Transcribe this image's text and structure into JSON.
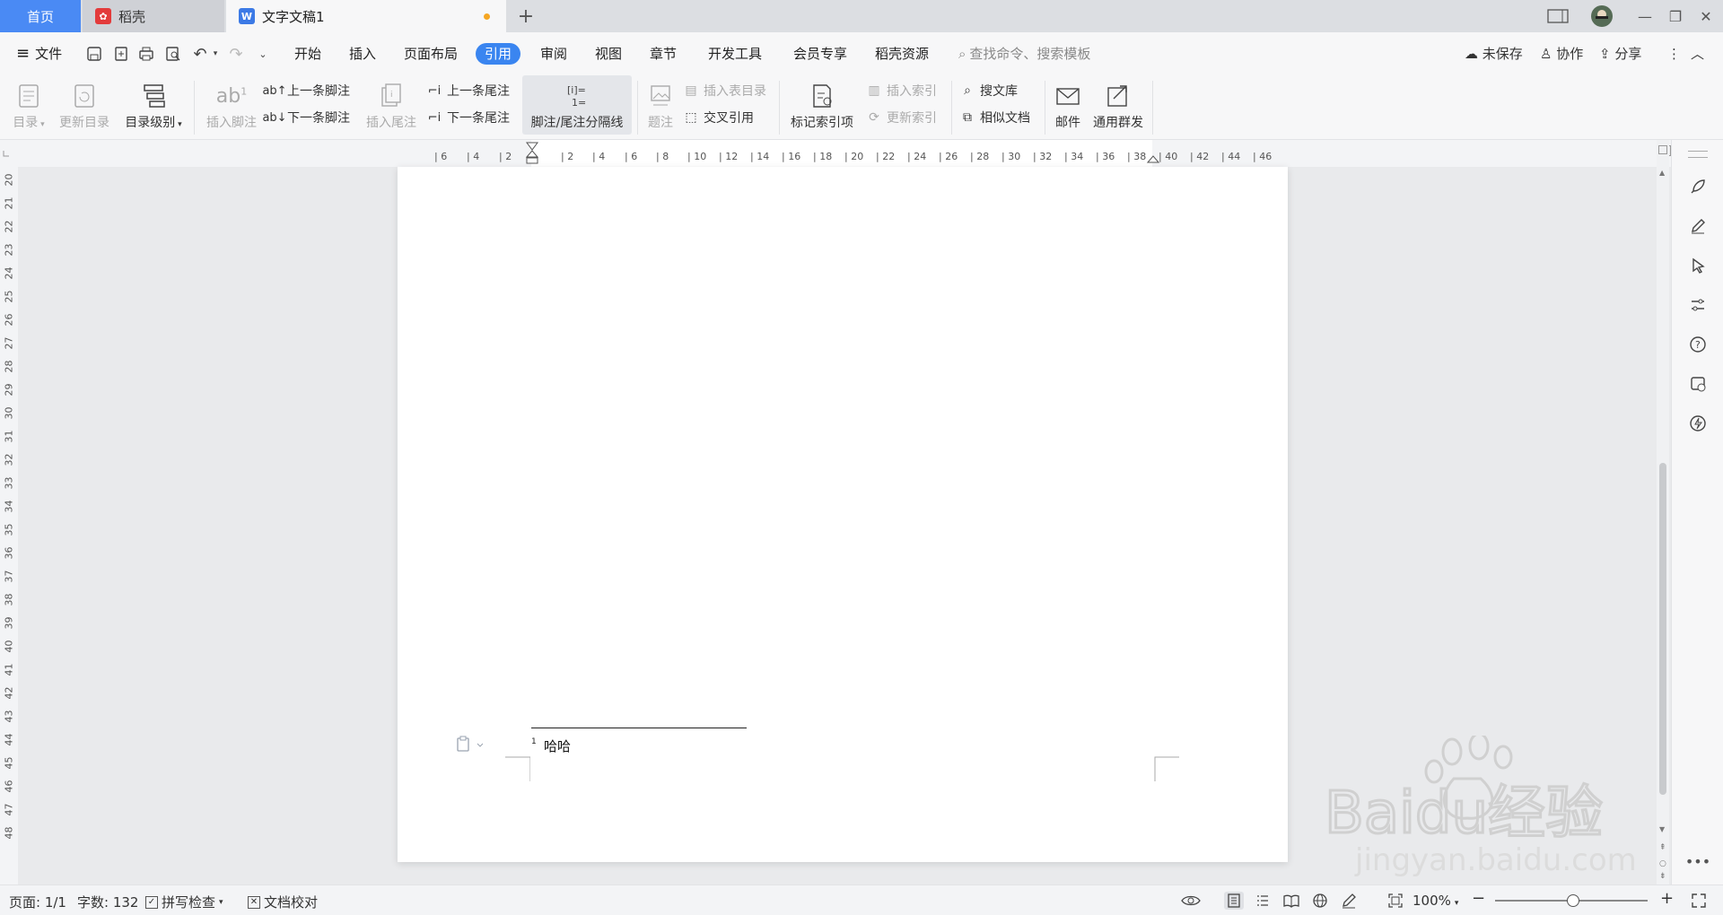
{
  "tabs": {
    "home": "首页",
    "daoke": "稻壳",
    "doc": "文字文稿1",
    "add": "+"
  },
  "window": {
    "page_badge": "1",
    "minimize": "—",
    "restore": "❐",
    "close": "✕"
  },
  "menu": {
    "file": "文件",
    "items": [
      "开始",
      "插入",
      "页面布局",
      "引用",
      "审阅",
      "视图",
      "章节",
      "开发工具",
      "会员专享",
      "稻壳资源"
    ],
    "active": "引用",
    "search_placeholder": "查找命令、搜索模板",
    "unsaved": "未保存",
    "collab": "协作",
    "share": "分享"
  },
  "ribbon": {
    "toc": "目录",
    "update_toc": "更新目录",
    "toc_level": "目录级别",
    "insert_footnote": "插入脚注",
    "prev_footnote": "上一条脚注",
    "next_footnote": "下一条脚注",
    "insert_endnote": "插入尾注",
    "prev_endnote": "上一条尾注",
    "next_endnote": "下一条尾注",
    "separator": "脚注/尾注分隔线",
    "caption": "题注",
    "insert_table_toc": "插入表目录",
    "cross_ref": "交叉引用",
    "mark_index": "标记索引项",
    "insert_index": "插入索引",
    "update_index": "更新索引",
    "search_lib": "搜文库",
    "similar_doc": "相似文档",
    "mail": "邮件",
    "group_send": "通用群发"
  },
  "ruler": {
    "h_ticks": [
      "6",
      "4",
      "2",
      "2",
      "4",
      "6",
      "8",
      "10",
      "12",
      "14",
      "16",
      "18",
      "20",
      "22",
      "24",
      "26",
      "28",
      "30",
      "32",
      "34",
      "36",
      "38",
      "40",
      "42",
      "44",
      "46"
    ],
    "v_ticks": [
      "20",
      "21",
      "22",
      "23",
      "24",
      "25",
      "26",
      "27",
      "28",
      "29",
      "30",
      "31",
      "32",
      "33",
      "34",
      "35",
      "36",
      "37",
      "38",
      "39",
      "40",
      "41",
      "42",
      "43",
      "44",
      "45",
      "46",
      "47",
      "48"
    ]
  },
  "document": {
    "footnote_number": "1",
    "footnote_text": "哈哈"
  },
  "status": {
    "page": "页面: 1/1",
    "words": "字数: 132",
    "spell": "拼写检查",
    "proof": "文档校对",
    "zoom": "100%"
  },
  "watermark": {
    "brand": "Baidu经验",
    "url": "jingyan.baidu.com"
  },
  "colors": {
    "accent": "#3a85f0",
    "home_tab": "#4a8af4",
    "unsaved_dot": "#f5a623"
  }
}
